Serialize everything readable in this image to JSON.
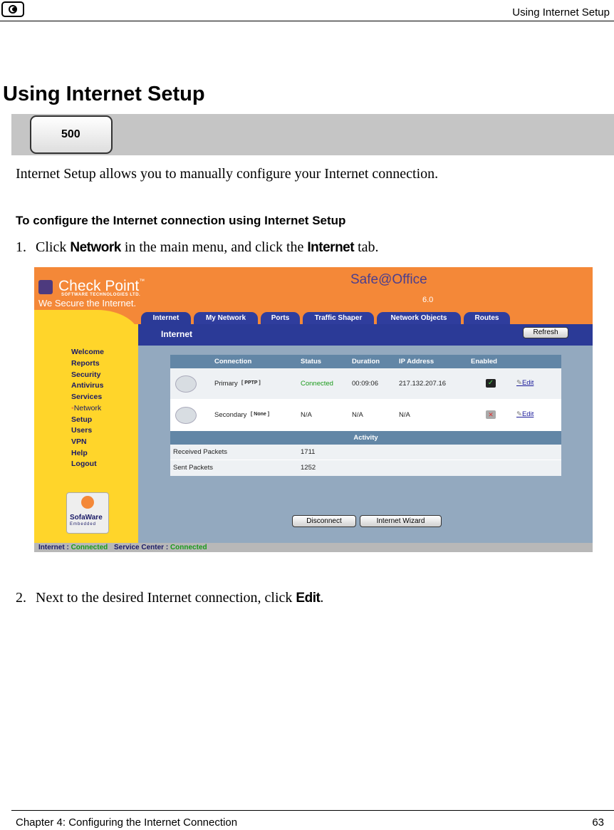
{
  "header": {
    "running_title": "Using Internet Setup"
  },
  "title": "Using Internet Setup",
  "model_badge": "500",
  "intro": "Internet Setup allows you to manually configure your Internet connection.",
  "procedure_title": "To configure the Internet connection using Internet Setup",
  "steps": [
    {
      "num": "1.",
      "pre": "Click ",
      "cmd1": "Network",
      "mid": " in the main menu, and click the ",
      "cmd2": "Internet",
      "post": " tab."
    },
    {
      "num": "2.",
      "pre": "Next to the desired Internet connection, click ",
      "cmd1": "Edit",
      "post": "."
    }
  ],
  "screenshot": {
    "brand": "Check Point",
    "brand_tm": "™",
    "brand_sub": "SOFTWARE TECHNOLOGIES LTD.",
    "tagline": "We Secure the Internet.",
    "product": "Safe@Office",
    "version": "6.0",
    "tabs": [
      "Internet",
      "My Network",
      "Ports",
      "Traffic Shaper",
      "Network Objects",
      "Routes"
    ],
    "section_title": "Internet",
    "refresh": "Refresh",
    "menu": [
      "Welcome",
      "Reports",
      "Security",
      "Antivirus",
      "Services",
      "Network",
      "Setup",
      "Users",
      "VPN",
      "Help",
      "Logout"
    ],
    "sofaware": {
      "name": "SofaWare",
      "sub": "Embedded"
    },
    "table": {
      "headers": [
        "Connection",
        "Status",
        "Duration",
        "IP Address",
        "Enabled"
      ],
      "rows": [
        {
          "name": "Primary",
          "type": "[ PPTP ]",
          "status": "Connected",
          "duration": "00:09:06",
          "ip": "217.132.207.16",
          "edit": "Edit"
        },
        {
          "name": "Secondary",
          "type": "[ None ]",
          "status": "N/A",
          "duration": "N/A",
          "ip": "N/A",
          "edit": "Edit"
        }
      ],
      "activity_header": "Activity",
      "activity": [
        {
          "label": "Received Packets",
          "value": "1711"
        },
        {
          "label": "Sent Packets",
          "value": "1252"
        }
      ]
    },
    "buttons": {
      "disconnect": "Disconnect",
      "wizard": "Internet Wizard"
    },
    "status_bar": {
      "internet_label": "Internet : ",
      "internet_value": "Connected",
      "sc_label": "Service Center : ",
      "sc_value": "Connected"
    },
    "colors": {
      "orange": "#f48838",
      "navy": "#2b3a97",
      "yellow": "#ffd52a",
      "green": "#1a9a1a"
    }
  },
  "footer": {
    "chapter": "Chapter 4: Configuring the Internet Connection",
    "page": "63"
  }
}
